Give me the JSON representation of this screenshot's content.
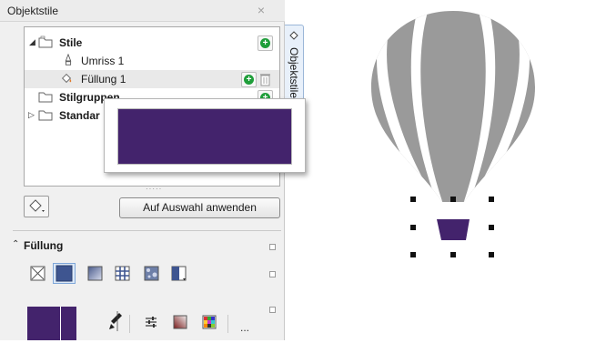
{
  "docker": {
    "title": "Objektstile",
    "close_glyph": "×",
    "vertical_tab": "Objektstile",
    "tree": {
      "styles_label": "Stile",
      "outline_label": "Umriss 1",
      "fill_label": "Füllung 1",
      "style_groups_label": "Stilgruppen",
      "defaults_label": "Standar"
    },
    "grip_dots": "·····",
    "apply_button": "Auf Auswahl anwenden",
    "fill_section_title": "Füllung",
    "more_button": "..."
  },
  "colors": {
    "fill_swatch": "#43236c",
    "balloon_gray": "#999999",
    "accent_green": "#1f9e3a"
  }
}
